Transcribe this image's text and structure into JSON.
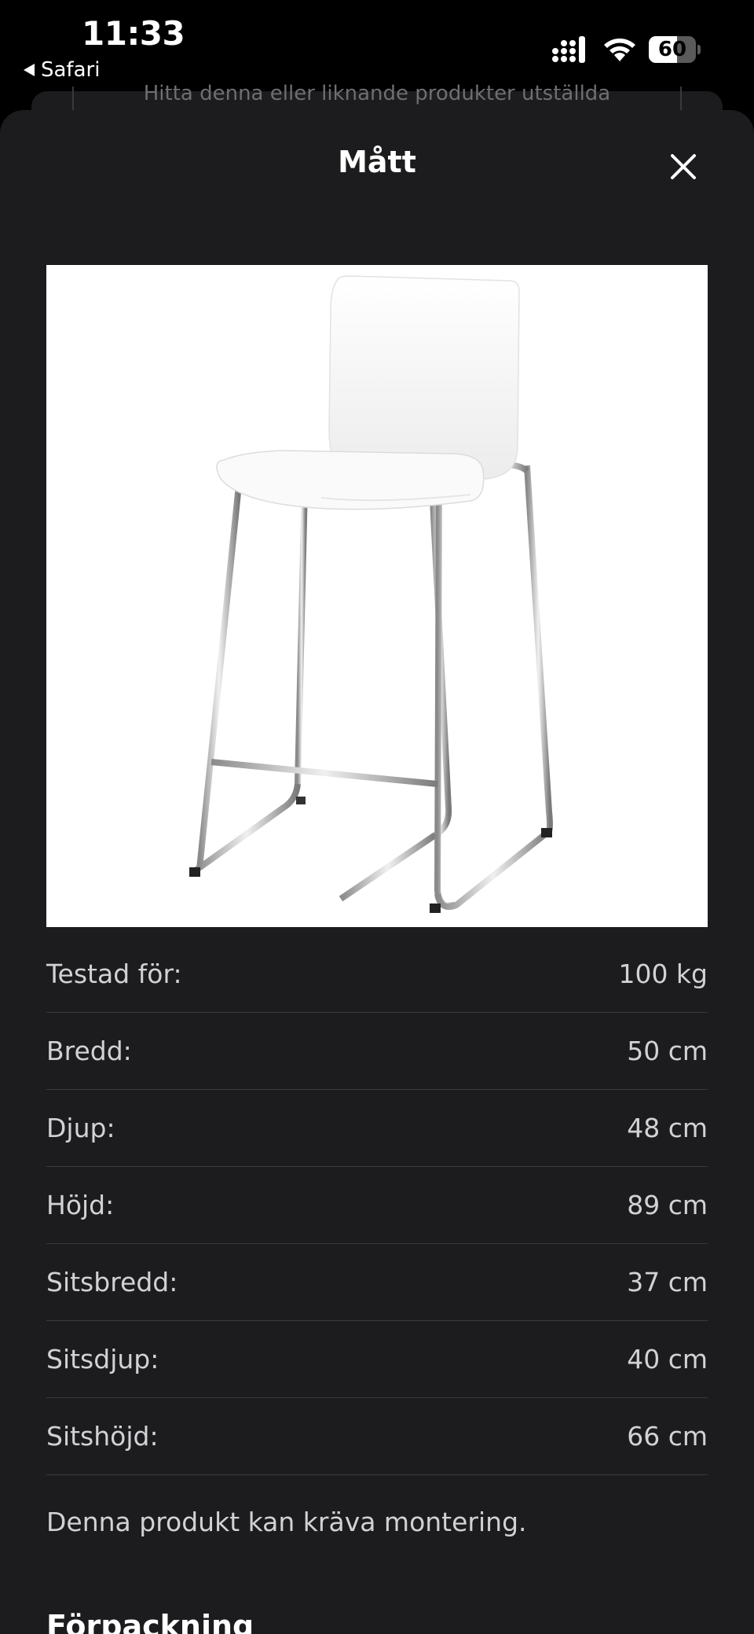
{
  "status_bar": {
    "time": "11:33",
    "back_label": "Safari",
    "battery_level": "60",
    "battery_fraction": 0.6
  },
  "background_page": {
    "text": "Hitta denna eller liknande produkter utställda"
  },
  "modal": {
    "title": "Mått",
    "close_icon": "close-icon",
    "image": "white-bar-stool-chrome-legs"
  },
  "dimensions": [
    {
      "label": "Testad för:",
      "value": "100 kg"
    },
    {
      "label": "Bredd:",
      "value": "50 cm"
    },
    {
      "label": "Djup:",
      "value": "48 cm"
    },
    {
      "label": "Höjd:",
      "value": "89 cm"
    },
    {
      "label": "Sitsbredd:",
      "value": "37 cm"
    },
    {
      "label": "Sitsdjup:",
      "value": "40 cm"
    },
    {
      "label": "Sitshöjd:",
      "value": "66 cm"
    }
  ],
  "note": "Denna produkt kan kräva montering.",
  "next_heading": "Förpackning"
}
